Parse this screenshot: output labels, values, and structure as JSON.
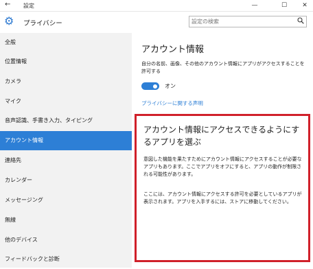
{
  "window": {
    "back_glyph": "←",
    "title": "設定",
    "controls": {
      "minimize": "—",
      "maximize": "☐",
      "close": "✕"
    }
  },
  "header": {
    "title": "プライバシー",
    "search_placeholder": "設定の検索",
    "search_icon": "search-icon"
  },
  "sidebar": {
    "selected_index": 5,
    "items": [
      {
        "label": "全般"
      },
      {
        "label": "位置情報"
      },
      {
        "label": "カメラ"
      },
      {
        "label": "マイク"
      },
      {
        "label": "音声認識、手書き入力、タイピング"
      },
      {
        "label": "アカウント情報"
      },
      {
        "label": "連絡先"
      },
      {
        "label": "カレンダー"
      },
      {
        "label": "メッセージング"
      },
      {
        "label": "無線"
      },
      {
        "label": "他のデバイス"
      },
      {
        "label": "フィードバックと診断"
      }
    ]
  },
  "main": {
    "section_title": "アカウント情報",
    "description": "自分の名前、画像、その他のアカウント情報にアプリがアクセスすることを許可する",
    "toggle": {
      "state": "on",
      "label": "オン"
    },
    "privacy_link": "プライバシーに関する声明",
    "apps_section": {
      "title": "アカウント情報にアクセスできるようにするアプリを選ぶ",
      "paragraph1": "意図した機能を果たすためにアカウント情報にアクセスすることが必要なアプリもあります。ここでアプリをオフにすると、アプリの動作が制限される可能性があります。",
      "paragraph2": "ここには、アカウント情報にアクセスする許可を必要としているアプリが表示されます。アプリを入手するには、ストアに移動してください。"
    }
  },
  "colors": {
    "accent": "#2d7fd6",
    "sidebar_bg": "#f2f2f2",
    "highlight_border": "#d0202a"
  }
}
